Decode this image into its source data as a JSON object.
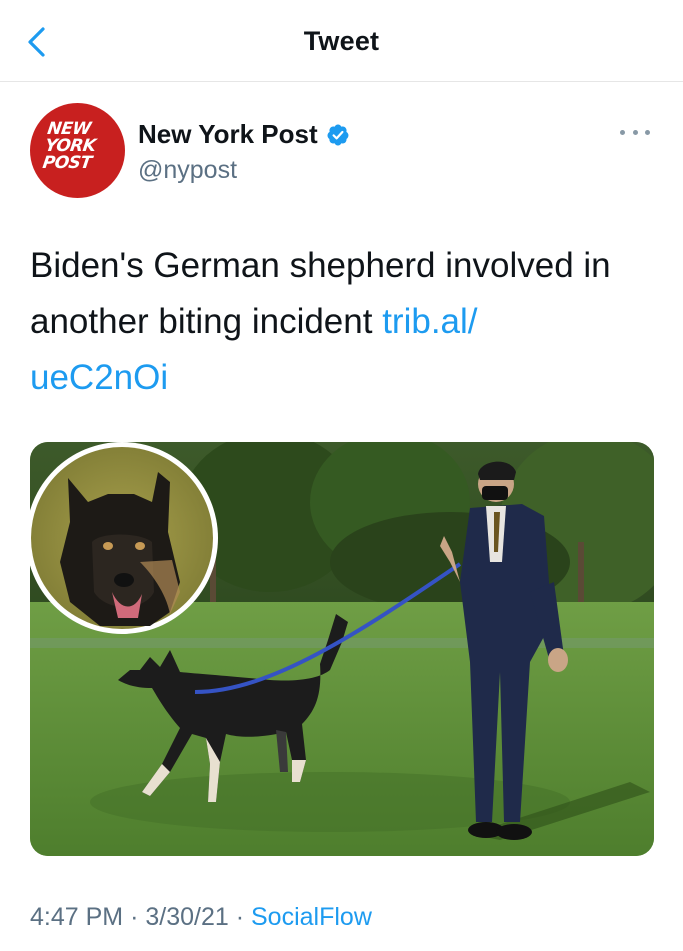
{
  "header": {
    "title": "Tweet",
    "back_icon": "chevron-left-icon"
  },
  "author": {
    "display_name": "New York Post",
    "handle": "@nypost",
    "verified": true,
    "avatar_lines": [
      "NEW",
      "YORK",
      "POST"
    ],
    "avatar_color": "#c8201f"
  },
  "tweet": {
    "text": "Biden's German shepherd involved in another biting incident",
    "link_line1": "trib.al/",
    "link_line2": "ueC2nOi",
    "link_color": "#1d9bf0"
  },
  "meta": {
    "time": "4:47 PM",
    "separator": "·",
    "date": "3/30/21",
    "source": "SocialFlow"
  },
  "colors": {
    "accent": "#1d9bf0",
    "secondary_text": "#5b7083"
  }
}
